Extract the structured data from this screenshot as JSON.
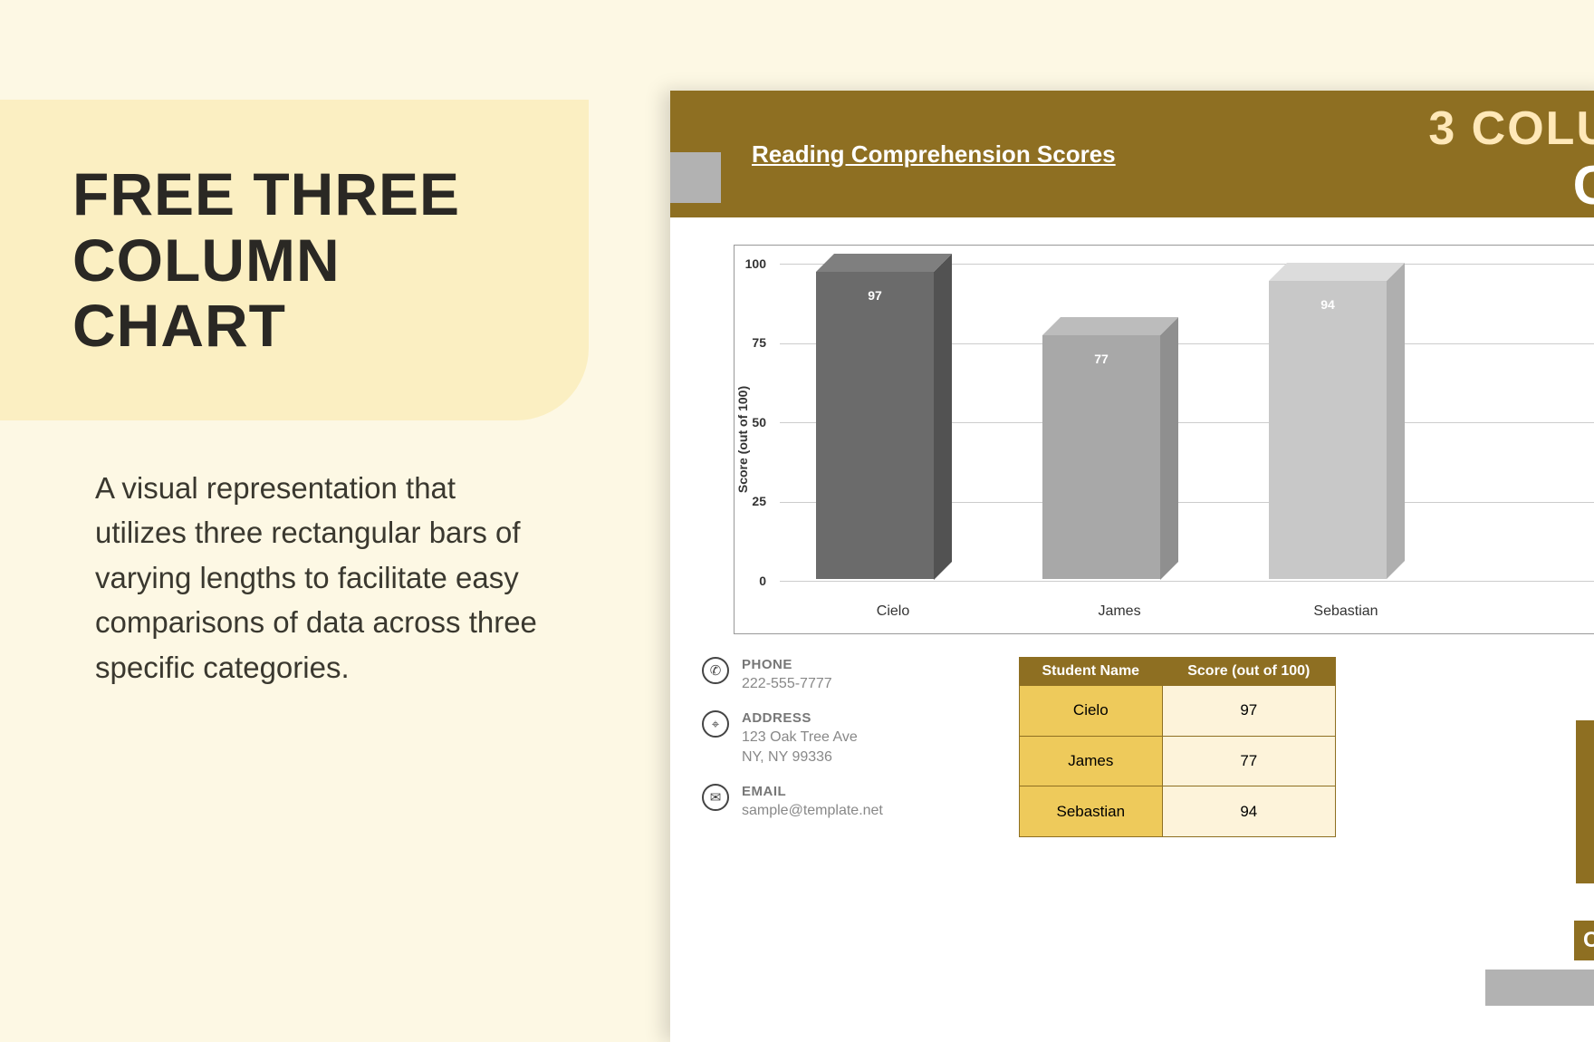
{
  "left": {
    "title_line1": "FREE THREE",
    "title_line2": "COLUMN CHART",
    "description": "A visual representation that utilizes three rectangular bars of varying lengths to facilitate easy comparisons of data across three specific categories."
  },
  "doc": {
    "subtitle": "Reading Comprehension Scores",
    "header_big1": "3 COLU",
    "header_big2": "C",
    "side_label": "Co"
  },
  "contact": {
    "phone_label": "PHONE",
    "phone_value": "222-555-7777",
    "address_label": "ADDRESS",
    "address_line1": "123 Oak Tree Ave",
    "address_line2": "NY, NY 99336",
    "email_label": "EMAIL",
    "email_value": "sample@template.net"
  },
  "table": {
    "header_name": "Student Name",
    "header_score": "Score (out of 100)",
    "rows": [
      {
        "name": "Cielo",
        "score": "97"
      },
      {
        "name": "James",
        "score": "77"
      },
      {
        "name": "Sebastian",
        "score": "94"
      }
    ]
  },
  "chart_data": {
    "type": "bar",
    "title": "Reading Comprehension Scores",
    "xlabel": "",
    "ylabel": "Score (out of 100)",
    "ylim": [
      0,
      100
    ],
    "y_ticks": [
      0,
      25,
      50,
      75,
      100
    ],
    "categories": [
      "Cielo",
      "James",
      "Sebastian"
    ],
    "values": [
      97,
      77,
      94
    ],
    "chart_3d": true,
    "bar_colors": [
      "#6b6b6b",
      "#a8a8a8",
      "#c8c8c8"
    ]
  }
}
